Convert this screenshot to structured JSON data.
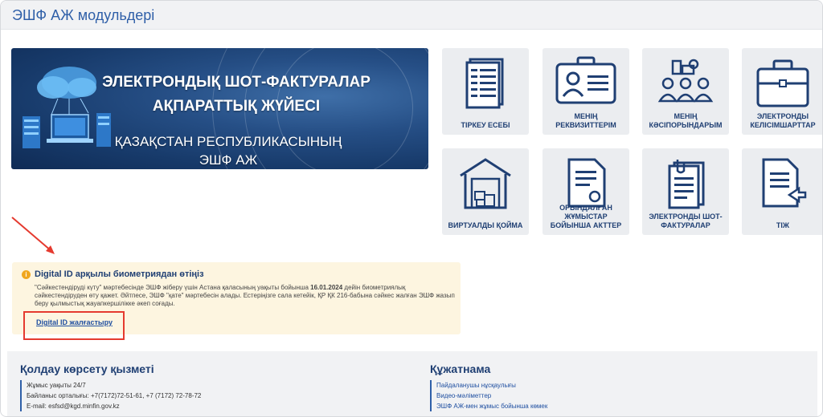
{
  "header": {
    "title": "ЭШФ АЖ модульдері"
  },
  "banner": {
    "line1": "ЭЛЕКТРОНДЫҚ ШОТ-ФАКТУРАЛАР",
    "line2": "АҚПАРАТТЫҚ ЖҮЙЕСІ",
    "line3": "ҚАЗАҚСТАН РЕСПУБЛИКАСЫНЫҢ",
    "line4": "ЭШФ АЖ"
  },
  "modules": [
    {
      "label": "ТІРКЕУ ЕСЕБІ",
      "icon": "registry-document-icon"
    },
    {
      "label": "МЕНІҢ РЕКВИЗИТТЕРІМ",
      "icon": "id-card-icon"
    },
    {
      "label": "МЕНІҢ КӘСІПОРЫНДАРЫМ",
      "icon": "enterprise-team-icon"
    },
    {
      "label": "ЭЛЕКТРОНДЫ КЕЛІСІМШАРТТАР",
      "icon": "briefcase-icon"
    },
    {
      "label": "ВИРТУАЛДЫ ҚОЙМА",
      "icon": "warehouse-icon"
    },
    {
      "label": "ОРЫНДАЛҒАН ЖҰМЫСТАР БОЙЫНША АКТТЕР",
      "icon": "certificate-document-icon"
    },
    {
      "label": "ЭЛЕКТРОНДЫ ШОТ-ФАКТУРАЛАР",
      "icon": "invoice-stack-icon"
    },
    {
      "label": "ТІЖ",
      "icon": "document-import-icon"
    }
  ],
  "notice": {
    "title": "Digital ID арқылы биометриядан өтіңіз",
    "body_part1": "\"Сәйкестендіруді күту\" мәртебесінде ЭШФ жіберу үшін Астана қаласының уақыты бойынша ",
    "body_date": "16.01.2024",
    "body_part2": " дейін биометриялық сәйкестендіруден өту қажет. Әйтпесе, ЭШФ \"қате\" мәртебесін алады. Естеріңізге сала кетейік, ҚР ҚК 216-бабына сәйкес жалған ЭШФ жазып беру қылмыстық жауапкершілікке әкеп соғады.",
    "link": "Digital ID жалғастыру"
  },
  "footer": {
    "support": {
      "title": "Қолдау көрсету қызметі",
      "items": [
        "Жұмыс уақыты 24/7",
        "Байланыс орталығы: +7(7172)72-51-61, +7 (7172) 72-78-72",
        "E-mail: esfsd@kgd.minfin.gov.kz"
      ]
    },
    "docs": {
      "title": "Құжатнама",
      "items": [
        "Пайдаланушы нұсқаулығы",
        "Видео-мәліметтер",
        "ЭШФ АЖ-мен жұмыс бойынша көмек"
      ]
    }
  },
  "colors": {
    "accent": "#2f5fa8",
    "annotation": "#e53a2f",
    "notice_bg": "#fdf5e0",
    "warning": "#f0a61f"
  }
}
